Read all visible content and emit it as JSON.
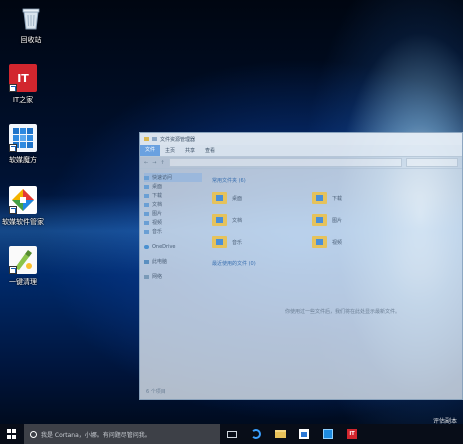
{
  "desktop": {
    "icons": [
      {
        "label": "回收站",
        "icon": "recycle-bin-icon"
      },
      {
        "label": "IT之家",
        "icon": "ithome-icon",
        "glyph": "IT"
      },
      {
        "label": "软媒魔方",
        "icon": "ruanmei-cube-icon"
      },
      {
        "label": "软媒软件管家",
        "icon": "software-manager-icon"
      },
      {
        "label": "一键清理",
        "icon": "one-click-clean-icon"
      }
    ],
    "watermark": "评估副本"
  },
  "explorer": {
    "title": "文件资源管理器",
    "ribbon_tabs": [
      "文件",
      "主页",
      "共享",
      "查看"
    ],
    "nav_items": [
      "快速访问",
      "桌面",
      "下载",
      "文档",
      "图片",
      "视频",
      "音乐",
      "OneDrive",
      "此电脑",
      "网络"
    ],
    "section_frequent": "常用文件夹 (6)",
    "folders": [
      "桌面",
      "下载",
      "文档",
      "图片",
      "音乐",
      "视频"
    ],
    "section_recent": "最近使用的文件 (0)",
    "empty_message": "你使用过一些文件后，我们将在此处显示最新文件。",
    "status": "6 个项目"
  },
  "taskbar": {
    "search_placeholder": "我是 Cortana，小娜。有问题尽管问我。",
    "pinned": [
      "task-view-icon",
      "edge-icon",
      "file-explorer-icon",
      "store-icon",
      "ruanmei-cube-icon",
      "ithome-icon"
    ],
    "it_glyph": "IT"
  },
  "colors": {
    "taskbar_bg": "#080e18",
    "search_bg": "#3d4047",
    "ribbon_active": "#468cdc",
    "ithome_red": "#d2262e"
  }
}
